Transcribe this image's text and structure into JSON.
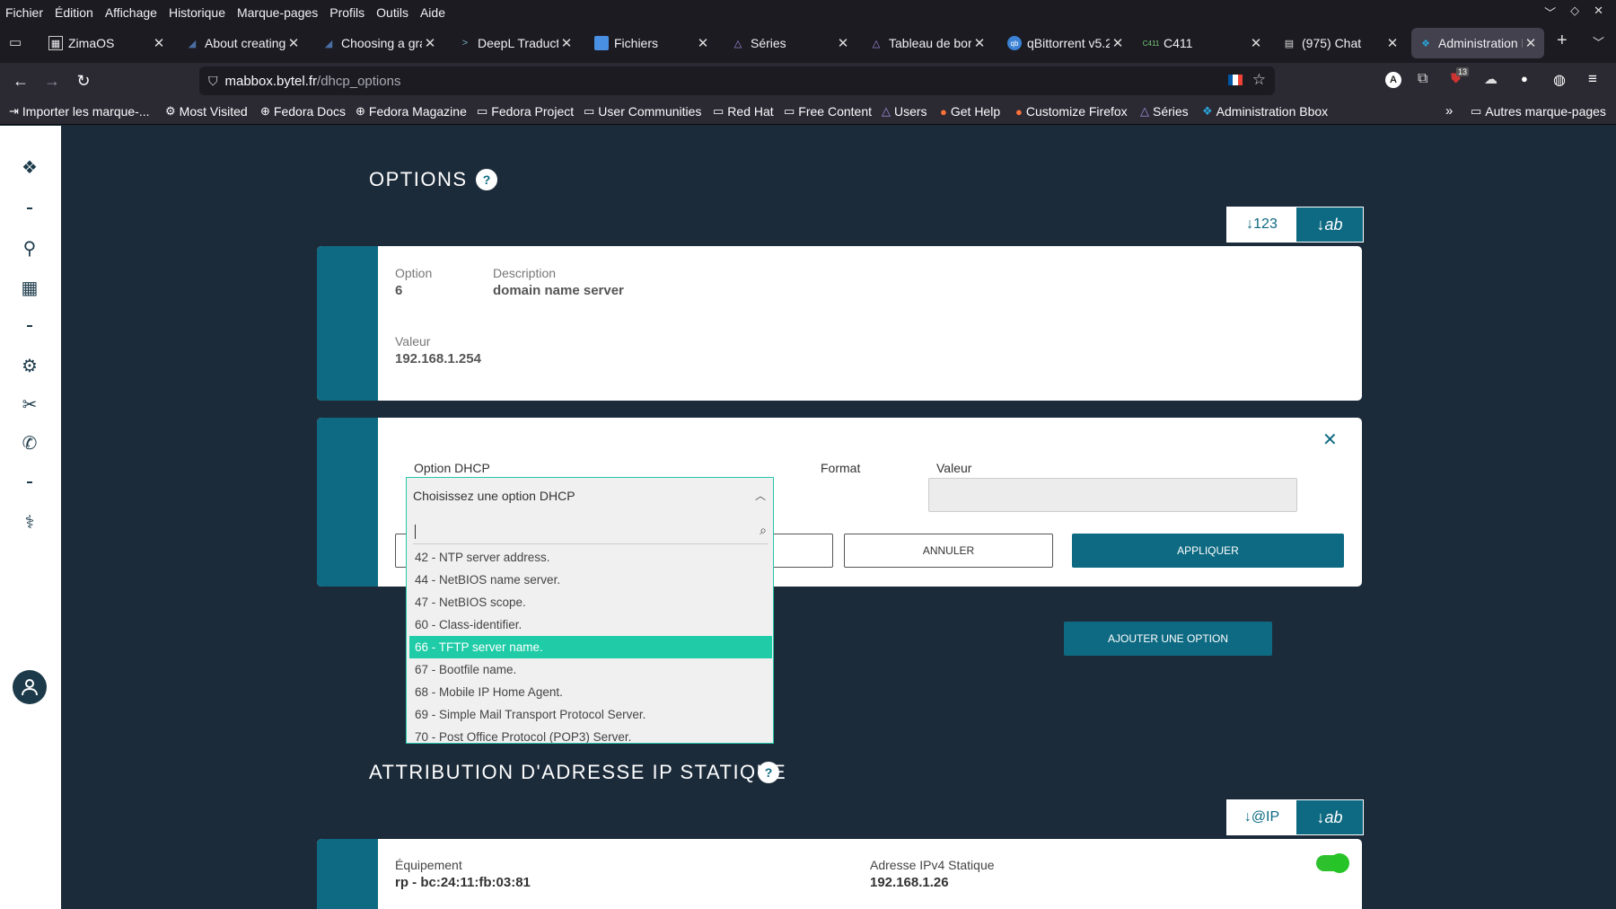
{
  "menubar": {
    "items": [
      "Fichier",
      "Édition",
      "Affichage",
      "Historique",
      "Marque-pages",
      "Profils",
      "Outils",
      "Aide"
    ]
  },
  "tabs": [
    {
      "title": "ZimaOS"
    },
    {
      "title": "About creating a"
    },
    {
      "title": "Choosing a grap"
    },
    {
      "title": "DeepL Traductio"
    },
    {
      "title": "Fichiers"
    },
    {
      "title": "Séries"
    },
    {
      "title": "Tableau de bord"
    },
    {
      "title": "qBittorrent v5.2"
    },
    {
      "title": "C411"
    },
    {
      "title": "(975) Chat"
    },
    {
      "title": "Administration B"
    }
  ],
  "url": {
    "host": "mabbox.bytel.fr",
    "path": "/dhcp_options"
  },
  "extension_badge": "13",
  "bookmarks": [
    "Importer les marque-...",
    "Most Visited",
    "Fedora Docs",
    "Fedora Magazine",
    "Fedora Project",
    "User Communities",
    "Red Hat",
    "Free Content",
    "Users",
    "Get Help",
    "Customize Firefox",
    "Séries",
    "Administration Bbox"
  ],
  "bookmarks_other": "Autres marque-pages",
  "options_section": {
    "title": "OPTIONS",
    "help": "?",
    "sort_numeric": "↓123",
    "sort_alpha": "↓ab"
  },
  "option_card": {
    "option_label": "Option",
    "option_value": "6",
    "description_label": "Description",
    "description_value": "domain name server",
    "valeur_label": "Valeur",
    "valeur_value": "192.168.1.254"
  },
  "edit_card": {
    "option_dhcp_label": "Option DHCP",
    "format_label": "Format",
    "valeur_label": "Valeur",
    "annuler": "ANNULER",
    "appliquer": "APPLIQUER",
    "close": "✕"
  },
  "dropdown": {
    "placeholder": "Choisissez une option DHCP",
    "items": [
      "42 - NTP server address.",
      "44 - NetBIOS name server.",
      "47 - NetBIOS scope.",
      "60 - Class-identifier.",
      "66 - TFTP server name.",
      "67 - Bootfile name.",
      "68 - Mobile IP Home Agent.",
      "69 - Simple Mail Transport Protocol Server.",
      "70 - Post Office Protocol (POP3) Server."
    ],
    "selected_index": 4
  },
  "add_option_button": "AJOUTER UNE OPTION",
  "static_section": {
    "title": "ATTRIBUTION D'ADRESSE IP STATIQUE",
    "help": "?",
    "sort_ip": "↓@IP",
    "sort_alpha": "↓ab"
  },
  "static_card": {
    "equipement_label": "Équipement",
    "equipement_value": "rp - bc:24:11:fb:03:81",
    "ipv4_label": "Adresse IPv4 Statique",
    "ipv4_value": "192.168.1.26",
    "enabled": true
  },
  "colors": {
    "accent": "#0e6a82",
    "page_bg": "#1c2b3a",
    "selection": "#1fcca7",
    "toggle": "#2ec12e"
  }
}
